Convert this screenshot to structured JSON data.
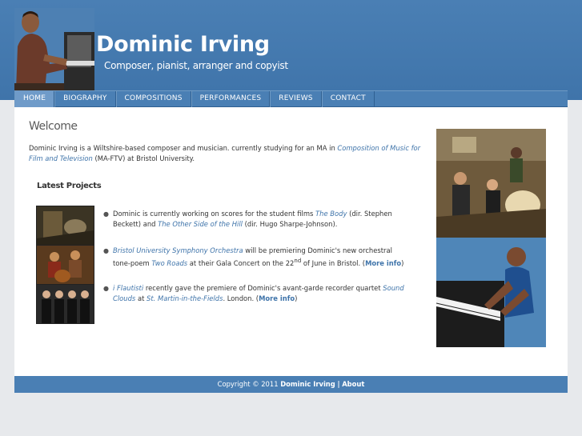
{
  "header": {
    "title": "Dominic Irving",
    "tagline": "Composer, pianist, arranger and copyist"
  },
  "nav": {
    "items": [
      "HOME",
      "BIOGRAPHY",
      "COMPOSITIONS",
      "PERFORMANCES",
      "REVIEWS",
      "CONTACT"
    ],
    "active": "HOME"
  },
  "main": {
    "heading": "Welcome",
    "intro_pre": "Dominic Irving is a Wiltshire-based composer and musician. currently studying for an MA in ",
    "intro_link": "Composition of Music for Film and Television",
    "intro_post": " (MA-FTV) at Bristol University.",
    "latest_heading": "Latest Projects",
    "projects": [
      {
        "p1": "Dominic is currently working on scores for the student films ",
        "l1": "The Body",
        "p2": " (dir. Stephen Beckett) and ",
        "l2": "The Other Side of the Hill",
        "p3": " (dir. Hugo Sharpe-Johnson)."
      },
      {
        "l1": "Bristol University Symphony Orchestra",
        "p1": " will be premiering Dominic's new orchestral tone-poem ",
        "l2": "Two Roads",
        "p2": " at their Gala Concert on the 22",
        "sup": "nd",
        "p3": " of June in Bristol. (",
        "more": "More info",
        "p4": ")"
      },
      {
        "l1": "i Flautisti",
        "p1": " recently gave the premiere of Dominic's avant-garde recorder quartet ",
        "l2": "Sound Clouds",
        "p2": " at ",
        "l3": "St. Martin-in-the-Fields",
        "p3": ". London. (",
        "more": "More info",
        "p4": ")"
      }
    ]
  },
  "footer": {
    "copyright": "Copyright © 2011",
    "name": "Dominic Irving",
    "sep": "|",
    "about": "About"
  },
  "colors": {
    "brand_blue": "#4a7fb4",
    "link": "#3f74aa",
    "nav_active": "#6f9bc9"
  }
}
